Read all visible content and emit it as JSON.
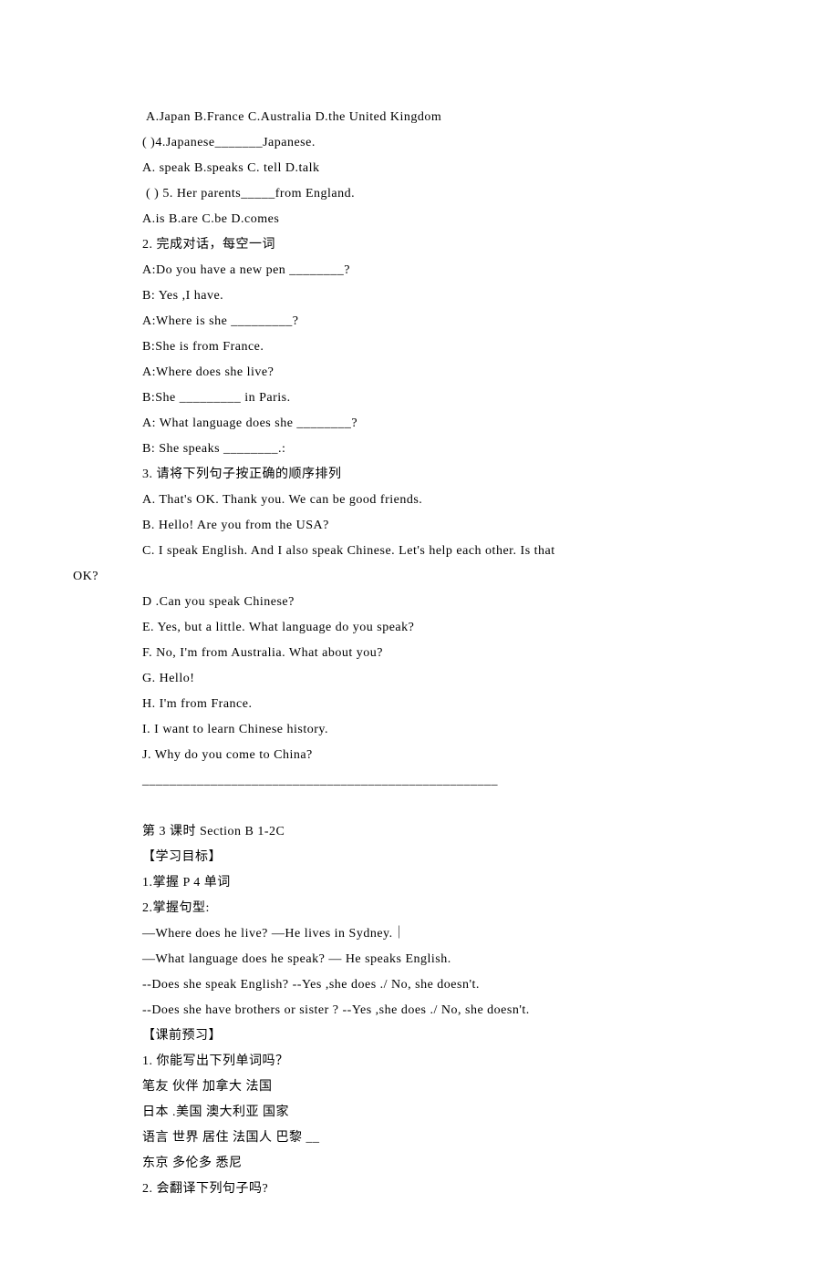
{
  "lines": [
    {
      "cls": "indent1",
      "text": " A.Japan B.France C.Australia D.the United Kingdom"
    },
    {
      "cls": "indent1",
      "text": "( )4.Japanese_______Japanese."
    },
    {
      "cls": "indent1",
      "text": "A. speak B.speaks C. tell D.talk"
    },
    {
      "cls": "indent1",
      "text": " ( ) 5. Her parents_____from England."
    },
    {
      "cls": "indent1",
      "text": "A.is B.are C.be D.comes"
    },
    {
      "cls": "indent1",
      "text": "2. 完成对话，每空一词"
    },
    {
      "cls": "indent1",
      "text": "A:Do you have a new pen ________?"
    },
    {
      "cls": "indent1",
      "text": "B: Yes ,I have."
    },
    {
      "cls": "indent1",
      "text": "A:Where is she _________?"
    },
    {
      "cls": "indent1",
      "text": "B:She is from France."
    },
    {
      "cls": "indent1",
      "text": "A:Where does she live?"
    },
    {
      "cls": "indent1",
      "text": "B:She _________ in Paris."
    },
    {
      "cls": "indent1",
      "text": "A: What language does she ________?"
    },
    {
      "cls": "indent1",
      "text": "B: She speaks ________.:"
    },
    {
      "cls": "indent1",
      "text": "3. 请将下列句子按正确的顺序排列"
    },
    {
      "cls": "indent1",
      "text": "A. That's OK. Thank you. We can be good friends."
    },
    {
      "cls": "indent1",
      "text": "B. Hello! Are you from the USA?"
    },
    {
      "cls": "indent1",
      "text": "C. I speak English. And I also speak Chinese. Let's help each other. Is that"
    },
    {
      "cls": "no-indent",
      "text": "OK?"
    },
    {
      "cls": "indent1",
      "text": "D .Can you speak Chinese?"
    },
    {
      "cls": "indent1",
      "text": "E. Yes, but a little. What language do you speak?"
    },
    {
      "cls": "indent1",
      "text": "F. No, I'm from Australia. What about you?"
    },
    {
      "cls": "indent1",
      "text": "G. Hello!"
    },
    {
      "cls": "indent1",
      "text": "H. I'm from France."
    },
    {
      "cls": "indent1",
      "text": "I. I want to learn Chinese history."
    },
    {
      "cls": "indent1",
      "text": "J. Why do you come to China?"
    },
    {
      "cls": "indent1",
      "text": "____________________________________________________"
    },
    {
      "cls": "spacer",
      "text": ""
    },
    {
      "cls": "indent1",
      "text": "第 3 课时 Section B 1-2C"
    },
    {
      "cls": "indent1",
      "text": "【学习目标】"
    },
    {
      "cls": "indent1",
      "text": "1.掌握 P 4 单词"
    },
    {
      "cls": "indent1",
      "text": "2.掌握句型:"
    },
    {
      "cls": "indent1",
      "text": "—Where does he live? —He lives in Sydney.｜"
    },
    {
      "cls": "indent1",
      "text": "—What language does he speak? — He speaks English."
    },
    {
      "cls": "indent1",
      "text": "--Does she speak English? --Yes ,she does ./ No, she doesn't."
    },
    {
      "cls": "indent1",
      "text": "--Does she have brothers or sister ? --Yes ,she does ./ No, she doesn't."
    },
    {
      "cls": "indent1",
      "text": "【课前预习】"
    },
    {
      "cls": "indent1",
      "text": "1. 你能写出下列单词吗？"
    },
    {
      "cls": "indent1",
      "text": "笔友 伙伴 加拿大 法国"
    },
    {
      "cls": "indent1",
      "text": "日本 .美国 澳大利亚 国家"
    },
    {
      "cls": "indent1",
      "text": "语言 世界 居住 法国人 巴黎 __"
    },
    {
      "cls": "indent1",
      "text": "东京 多伦多 悉尼"
    },
    {
      "cls": "indent1",
      "text": "2. 会翻译下列句子吗?"
    }
  ]
}
